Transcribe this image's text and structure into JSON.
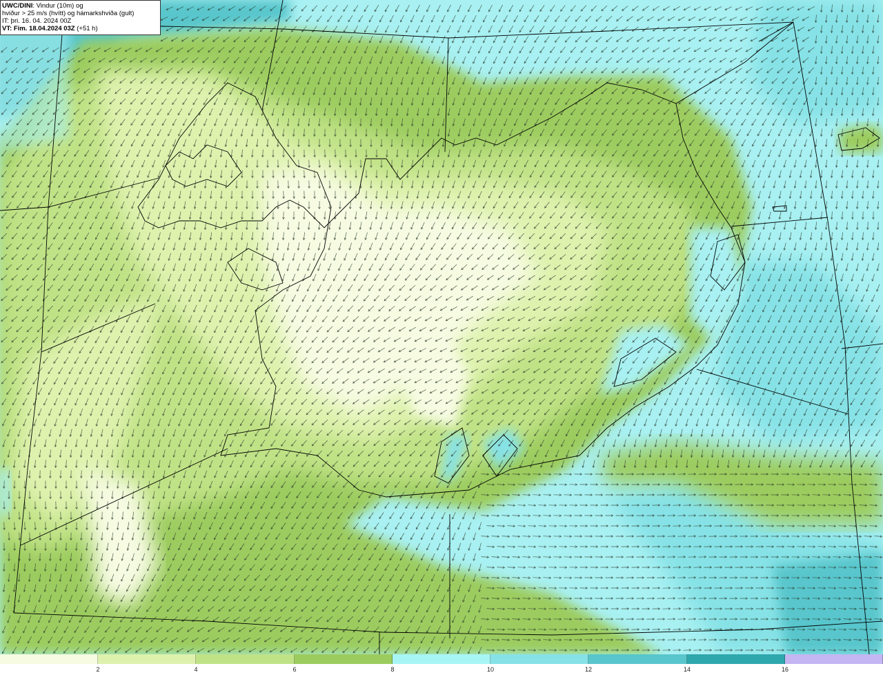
{
  "info": {
    "model": "UWC/DINI",
    "title_rest": ": Vindur (10m) og",
    "line2": "hviður > 25 m/s (hvítt) og hámarkshviða (gult)",
    "line3": "IT: þri. 16. 04. 2024 00Z",
    "vt_label": "VT: Fim. 18.04.2024 03Z",
    "vt_rest": " (+51 h)"
  },
  "legend": {
    "colors": [
      "#f6fbe2",
      "#def2ae",
      "#c0e286",
      "#9ccc5e",
      "#a8f5f5",
      "#86e2e6",
      "#58c6cc",
      "#2ea8ac",
      "#c4b6f2"
    ],
    "tick_labels": [
      "2",
      "4",
      "6",
      "8",
      "10",
      "12",
      "14",
      "16"
    ]
  },
  "colors": {
    "sea": "#a8f0f2",
    "sea_strong": "#82dde2",
    "land_low": "#f6fbe2",
    "land_mid": "#c0e286",
    "land_high": "#9ccc5e",
    "arrow": "#2d3a2d",
    "border": "#000000"
  }
}
